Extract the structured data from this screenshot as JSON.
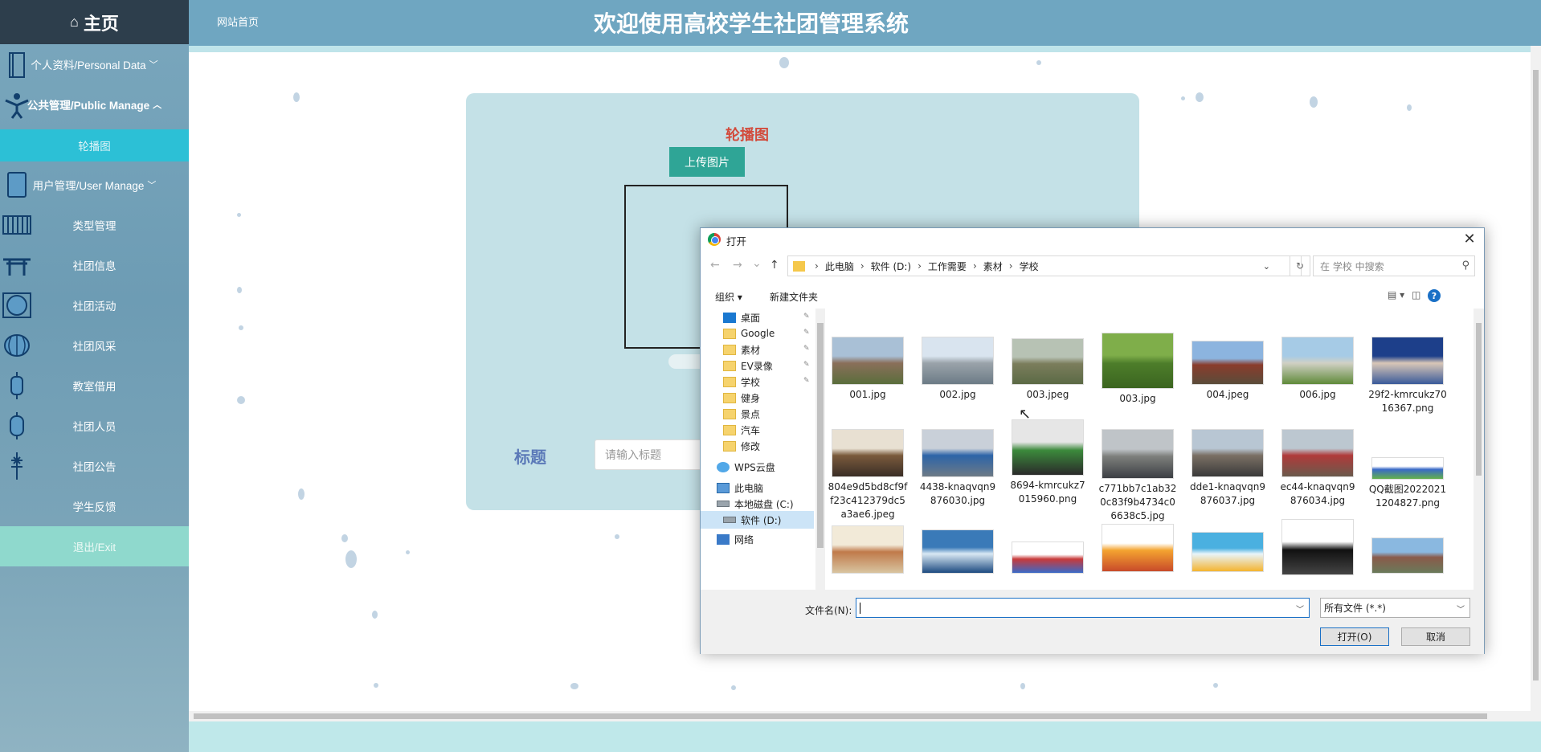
{
  "sidebar": {
    "home_label": "主页",
    "home_icon": "home-icon",
    "items": [
      {
        "label": "个人资料/Personal Data",
        "icon": "book-icon",
        "chevron": "chevron-down-icon"
      },
      {
        "label": "公共管理/Public Manage",
        "icon": "person-icon",
        "chevron": "chevron-up-icon"
      },
      {
        "label": "轮播图",
        "icon": ""
      },
      {
        "label": "用户管理/User Manage",
        "icon": "door-icon",
        "chevron": "chevron-down-icon"
      },
      {
        "label": "类型管理",
        "icon": "grid-icon"
      },
      {
        "label": "社团信息",
        "icon": "gate-icon"
      },
      {
        "label": "社团活动",
        "icon": "circle-icon"
      },
      {
        "label": "社团风采",
        "icon": "lantern-icon"
      },
      {
        "label": "教室借用",
        "icon": "lantern-icon"
      },
      {
        "label": "社团人员",
        "icon": "lantern-icon"
      },
      {
        "label": "社团公告",
        "icon": "knot-icon"
      },
      {
        "label": "学生反馈",
        "icon": ""
      },
      {
        "label": "退出/Exit",
        "icon": ""
      }
    ],
    "colors": {
      "active": "#2cc0d6",
      "exit": "#8fd9cd",
      "header": "#2d3e4c"
    }
  },
  "header": {
    "site_home": "网站首页",
    "title": "欢迎使用高校学生社团管理系统",
    "color": "#6fa6c1"
  },
  "form": {
    "section_title": "轮播图",
    "upload_label": "上传图片",
    "title_label": "标题",
    "title_placeholder": "请输入标题"
  },
  "dialog": {
    "title": "打开",
    "close": "✕",
    "nav": {
      "back": "←",
      "forward": "→",
      "recent": "⌄",
      "up": "↑"
    },
    "breadcrumb": [
      "此电脑",
      "软件 (D:)",
      "工作需要",
      "素材",
      "学校"
    ],
    "refresh": "↻",
    "search_placeholder": "在 学校 中搜索",
    "organize": "组织 ▾",
    "new_folder": "新建文件夹",
    "tree": [
      {
        "label": "桌面",
        "icon": "desktop-icon",
        "pinned": true
      },
      {
        "label": "Google",
        "icon": "folder-icon",
        "pinned": true
      },
      {
        "label": "素材",
        "icon": "folder-icon",
        "pinned": true
      },
      {
        "label": "EV录像",
        "icon": "folder-icon",
        "pinned": true
      },
      {
        "label": "学校",
        "icon": "folder-icon",
        "pinned": true
      },
      {
        "label": "健身",
        "icon": "folder-icon",
        "pinned": false
      },
      {
        "label": "景点",
        "icon": "folder-icon",
        "pinned": false
      },
      {
        "label": "汽车",
        "icon": "folder-icon",
        "pinned": false
      },
      {
        "label": "修改",
        "icon": "folder-icon",
        "pinned": false
      },
      {
        "label": "WPS云盘",
        "icon": "cloud-icon",
        "pinned": false
      },
      {
        "label": "此电脑",
        "icon": "pc-icon",
        "pinned": false
      },
      {
        "label": "本地磁盘 (C:)",
        "icon": "drive-icon",
        "pinned": false
      },
      {
        "label": "软件 (D:)",
        "icon": "drive-icon",
        "pinned": false,
        "selected": true
      },
      {
        "label": "网络",
        "icon": "network-icon",
        "pinned": false
      }
    ],
    "files": [
      {
        "name": "001.jpg",
        "colors": [
          "#a9c0d6",
          "#8a6f5a",
          "#5a6e3c"
        ]
      },
      {
        "name": "002.jpg",
        "colors": [
          "#d9e4ef",
          "#9aa3aa",
          "#6c7b86"
        ]
      },
      {
        "name": "003.jpeg",
        "colors": [
          "#b7c2b4",
          "#7b7d5c",
          "#5b6a45"
        ]
      },
      {
        "name": "003.jpg",
        "colors": [
          "#7fae4a",
          "#4d7d2a",
          "#3b6520"
        ]
      },
      {
        "name": "004.jpeg",
        "colors": [
          "#8cb4df",
          "#8a3c2c",
          "#5a4c3a"
        ]
      },
      {
        "name": "006.jpg",
        "colors": [
          "#a6cbe6",
          "#d1d0c4",
          "#5f8a3a"
        ]
      },
      {
        "name": "29f2-kmrcukz7016367.png",
        "colors": [
          "#1d3f8a",
          "#d9c7b7",
          "#3a5a9a"
        ]
      },
      {
        "name": "804e9d5bd8cf9ff23c412379dc5a3ae6.jpeg",
        "colors": [
          "#e8e0d2",
          "#7a5a3c",
          "#3a2e26"
        ]
      },
      {
        "name": "4438-knaqvqn9876030.jpg",
        "colors": [
          "#c9d0d9",
          "#2d64a8",
          "#6d7a86"
        ]
      },
      {
        "name": "8694-kmrcukz7015960.png",
        "colors": [
          "#e6e6e6",
          "#3c8a3c",
          "#2a2a2a"
        ]
      },
      {
        "name": "c771bb7c1ab320c83f9b4734c06638c5.jpg",
        "colors": [
          "#bfc4c8",
          "#7d7f7c",
          "#3c3f44"
        ]
      },
      {
        "name": "dde1-knaqvqn9876037.jpg",
        "colors": [
          "#b8c6d3",
          "#7a6f64",
          "#3a3a3a"
        ]
      },
      {
        "name": "ec44-knaqvqn9876034.jpg",
        "colors": [
          "#bcc7d0",
          "#b03a3a",
          "#6a5a4c"
        ]
      },
      {
        "name": "QQ截图20220211204827.png",
        "colors": [
          "#ffffff",
          "#3a6ac8",
          "#63b04a"
        ]
      },
      {
        "name": "",
        "colors": [
          "#f2ead8",
          "#c07a4a",
          "#d8c4a0"
        ]
      },
      {
        "name": "",
        "colors": [
          "#3a7ab8",
          "#d8e8f4",
          "#1d4a80"
        ]
      },
      {
        "name": "",
        "colors": [
          "#ffffff",
          "#c83a3a",
          "#3a6ac8"
        ]
      },
      {
        "name": "",
        "colors": [
          "#ffffff",
          "#f4a430",
          "#c84a2a"
        ]
      },
      {
        "name": "",
        "colors": [
          "#4ab0e0",
          "#e8f4fa",
          "#f4b430"
        ]
      },
      {
        "name": "",
        "colors": [
          "#ffffff",
          "#111111",
          "#444444"
        ]
      },
      {
        "name": "",
        "colors": [
          "#8ab8e0",
          "#8a5a4a",
          "#6a7a5a"
        ]
      }
    ],
    "filename_label": "文件名(N):",
    "filename_value": "",
    "filetype": "所有文件 (*.*)",
    "open_label": "打开(O)",
    "cancel_label": "取消"
  }
}
